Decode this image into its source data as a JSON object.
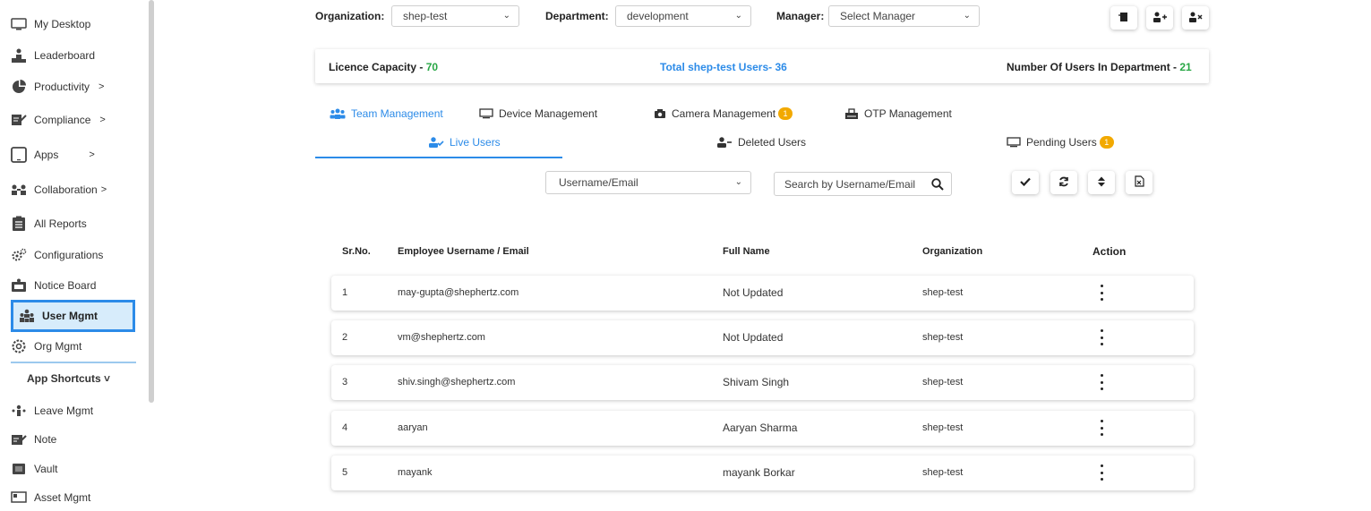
{
  "sidebar": {
    "items": [
      {
        "label": "My Desktop",
        "icon": "desktop-icon",
        "chevron": ""
      },
      {
        "label": "Leaderboard",
        "icon": "leaderboard-icon",
        "chevron": ""
      },
      {
        "label": "Productivity",
        "icon": "pie-chart-icon",
        "chevron": ">"
      },
      {
        "label": "Compliance",
        "icon": "compliance-icon",
        "chevron": ">"
      },
      {
        "label": "Apps",
        "icon": "tablet-icon",
        "chevron": ">"
      },
      {
        "label": "Collaboration",
        "icon": "collaboration-icon",
        "chevron": ">"
      },
      {
        "label": "All Reports",
        "icon": "reports-icon",
        "chevron": ""
      },
      {
        "label": "Configurations",
        "icon": "gears-icon",
        "chevron": ""
      },
      {
        "label": "Notice Board",
        "icon": "notice-board-icon",
        "chevron": ""
      },
      {
        "label": "User Mgmt",
        "icon": "users-icon",
        "chevron": ""
      },
      {
        "label": "Org Mgmt",
        "icon": "org-gear-icon",
        "chevron": ""
      }
    ],
    "shortcuts_title": "App Shortcuts",
    "shortcuts_chevron": "˅",
    "shortcuts": [
      {
        "label": "Leave Mgmt",
        "icon": "leave-icon"
      },
      {
        "label": "Note",
        "icon": "note-icon"
      },
      {
        "label": "Vault",
        "icon": "vault-icon"
      },
      {
        "label": "Asset Mgmt",
        "icon": "asset-icon"
      }
    ]
  },
  "filters": {
    "organization_label": "Organization:",
    "organization_value": "shep-test",
    "department_label": "Department:",
    "department_value": "development",
    "manager_label": "Manager:",
    "manager_value": "Select Manager"
  },
  "info": {
    "licence_label": "Licence Capacity - ",
    "licence_value": "70",
    "total_users": "Total shep-test Users- 36",
    "dept_label": "Number Of Users In Department - ",
    "dept_value": "21"
  },
  "tabs": {
    "team": "Team Management",
    "device": "Device Management",
    "camera": "Camera Management",
    "camera_badge": "1",
    "otp": "OTP Management"
  },
  "subtabs": {
    "live": "Live Users",
    "deleted": "Deleted Users",
    "pending": "Pending Users",
    "pending_badge": "1"
  },
  "search": {
    "filter_value": "Username/Email",
    "placeholder": "Search by Username/Email"
  },
  "table": {
    "headers": {
      "srno": "Sr.No.",
      "username": "Employee Username / Email",
      "fullname": "Full Name",
      "organization": "Organization",
      "action": "Action"
    },
    "rows": [
      {
        "sr": "1",
        "username": "may-gupta@shephertz.com",
        "fullname": "Not Updated",
        "org": "shep-test"
      },
      {
        "sr": "2",
        "username": "vm@shephertz.com",
        "fullname": "Not Updated",
        "org": "shep-test"
      },
      {
        "sr": "3",
        "username": "shiv.singh@shephertz.com",
        "fullname": "Shivam Singh",
        "org": "shep-test"
      },
      {
        "sr": "4",
        "username": "aaryan",
        "fullname": "Aaryan Sharma",
        "org": "shep-test"
      },
      {
        "sr": "5",
        "username": "mayank",
        "fullname": "mayank Borkar",
        "org": "shep-test"
      }
    ]
  },
  "colors": {
    "accent": "#2c8be8",
    "green": "#28a745",
    "badge": "#f2a900",
    "active_bg": "#d7ecfb"
  }
}
